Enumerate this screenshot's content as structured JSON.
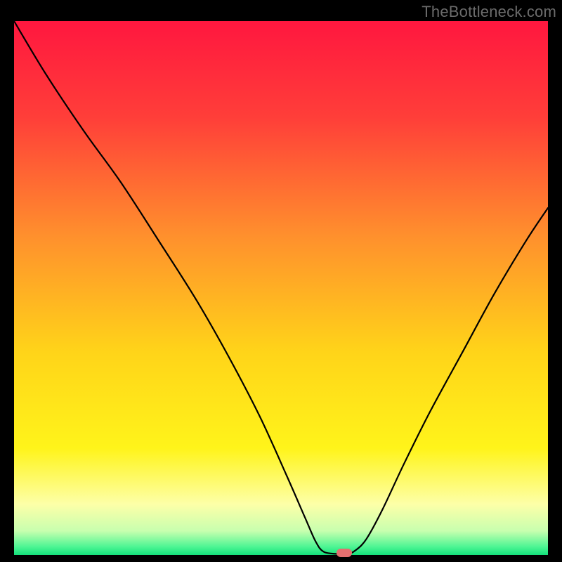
{
  "watermark": "TheBottleneck.com",
  "chart_data": {
    "type": "line",
    "title": "",
    "xlabel": "",
    "ylabel": "",
    "xlim": [
      0,
      100
    ],
    "ylim": [
      0,
      100
    ],
    "grid": false,
    "legend": false,
    "background_gradient_stops": [
      {
        "offset": 0.0,
        "color": "#ff173f"
      },
      {
        "offset": 0.18,
        "color": "#ff3e39"
      },
      {
        "offset": 0.4,
        "color": "#ff8f2d"
      },
      {
        "offset": 0.62,
        "color": "#ffd419"
      },
      {
        "offset": 0.8,
        "color": "#fff41a"
      },
      {
        "offset": 0.905,
        "color": "#fdffa8"
      },
      {
        "offset": 0.955,
        "color": "#c8ffaf"
      },
      {
        "offset": 0.985,
        "color": "#4cf593"
      },
      {
        "offset": 1.0,
        "color": "#14e07a"
      }
    ],
    "series": [
      {
        "name": "bottleneck-curve",
        "stroke": "#000000",
        "stroke_width": 2.2,
        "points": [
          {
            "x": 0.0,
            "y": 100.0
          },
          {
            "x": 6.0,
            "y": 90.0
          },
          {
            "x": 13.0,
            "y": 79.5
          },
          {
            "x": 20.0,
            "y": 69.8
          },
          {
            "x": 27.0,
            "y": 59.0
          },
          {
            "x": 34.0,
            "y": 48.0
          },
          {
            "x": 40.0,
            "y": 37.5
          },
          {
            "x": 46.0,
            "y": 26.0
          },
          {
            "x": 51.0,
            "y": 15.0
          },
          {
            "x": 54.5,
            "y": 7.0
          },
          {
            "x": 56.5,
            "y": 2.5
          },
          {
            "x": 58.0,
            "y": 0.6
          },
          {
            "x": 60.5,
            "y": 0.2
          },
          {
            "x": 62.5,
            "y": 0.2
          },
          {
            "x": 64.0,
            "y": 0.9
          },
          {
            "x": 66.0,
            "y": 3.0
          },
          {
            "x": 69.0,
            "y": 8.5
          },
          {
            "x": 73.0,
            "y": 17.0
          },
          {
            "x": 78.0,
            "y": 27.0
          },
          {
            "x": 84.0,
            "y": 38.0
          },
          {
            "x": 90.0,
            "y": 49.0
          },
          {
            "x": 96.0,
            "y": 59.0
          },
          {
            "x": 100.0,
            "y": 65.0
          }
        ]
      }
    ],
    "markers": [
      {
        "name": "optimal-point",
        "x": 61.8,
        "y": 0.4,
        "color": "#e46f6f"
      }
    ]
  }
}
